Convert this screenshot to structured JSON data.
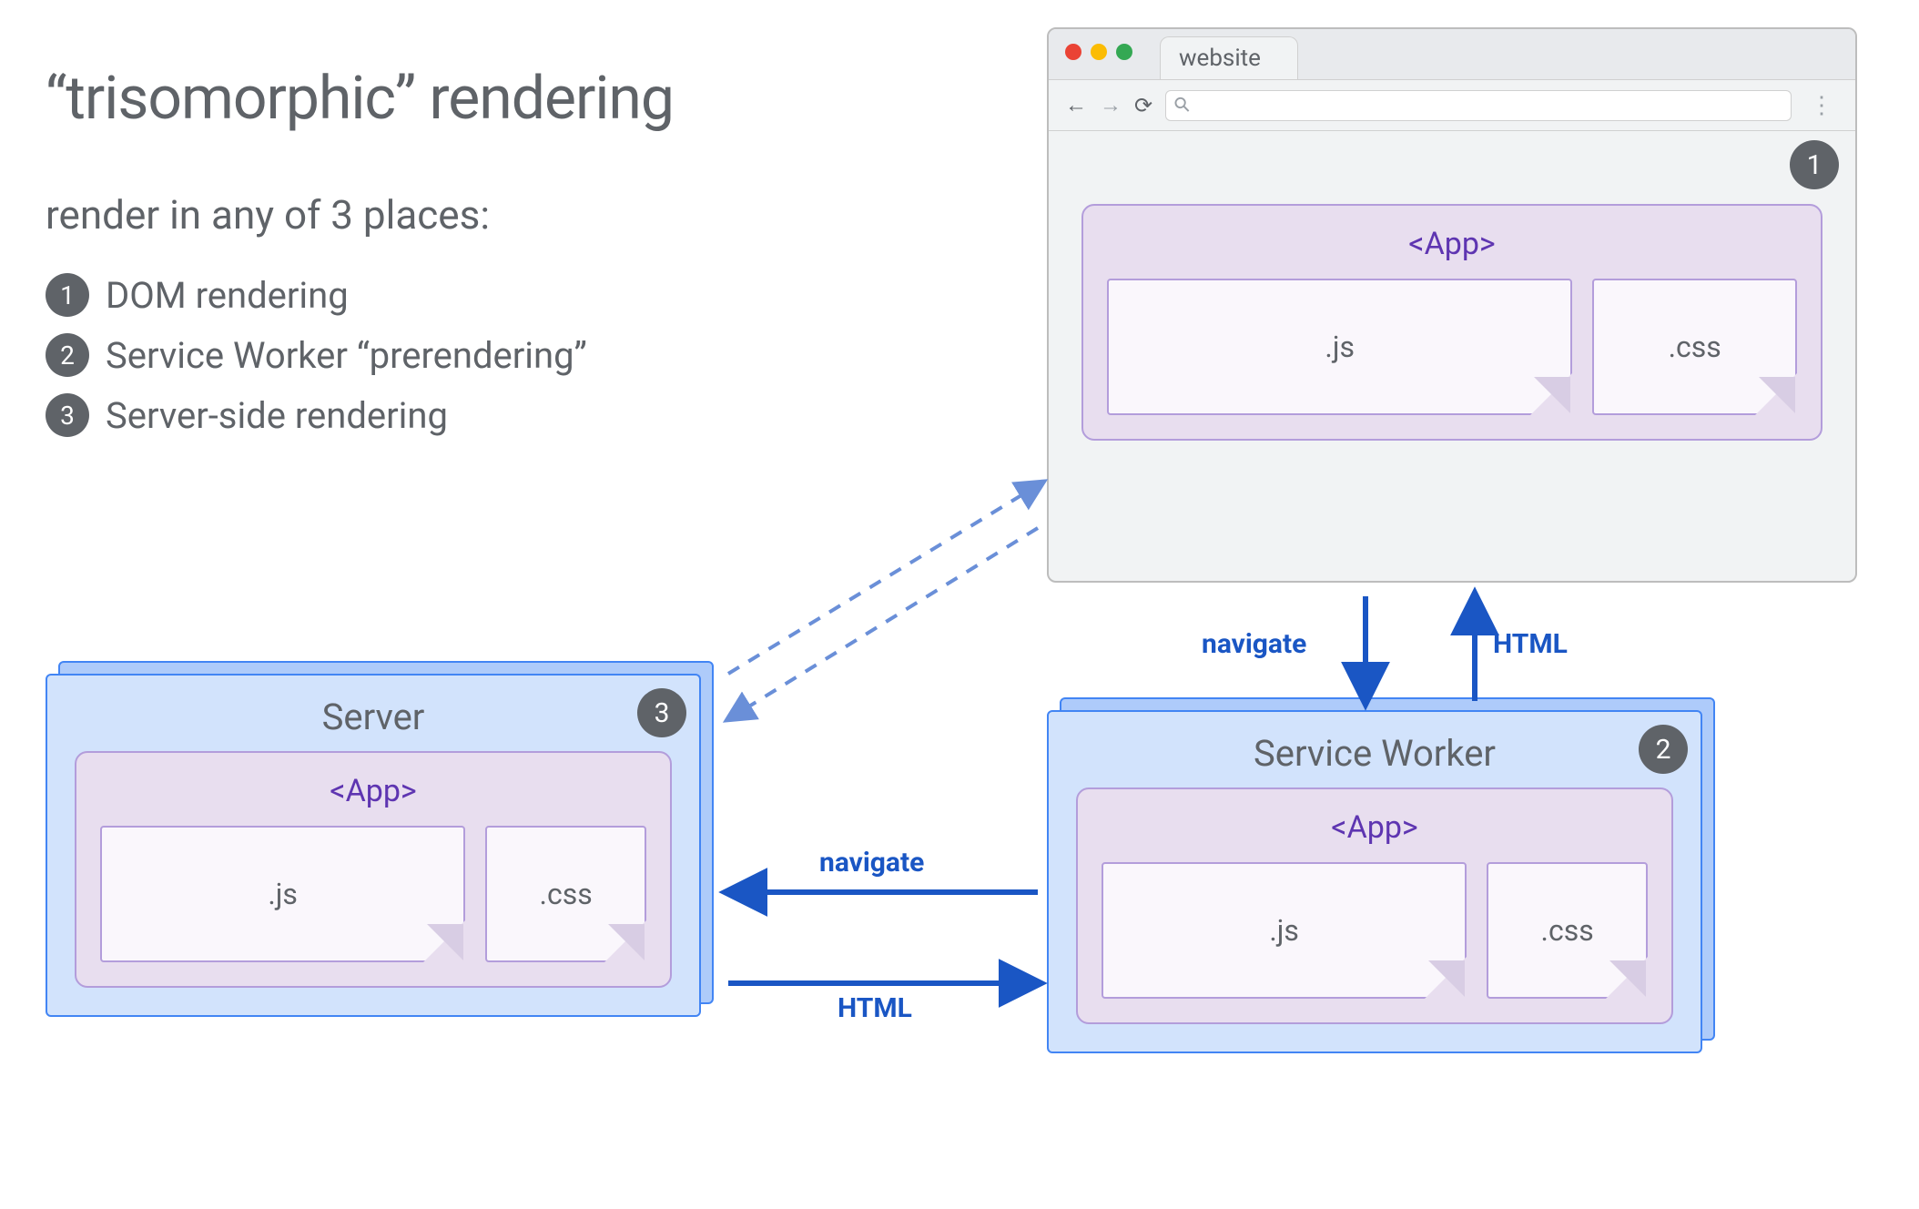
{
  "title": "“trisomorphic” rendering",
  "subtitle": "render in any of 3 places:",
  "items": [
    {
      "num": "1",
      "label": "DOM rendering"
    },
    {
      "num": "2",
      "label": "Service Worker “prerendering”"
    },
    {
      "num": "3",
      "label": "Server-side rendering"
    }
  ],
  "browser": {
    "tab_label": "website",
    "search_glyph": "⚲",
    "badge": "1",
    "app_label": "<App>",
    "js_label": ".js",
    "css_label": ".css"
  },
  "server": {
    "title": "Server",
    "badge": "3",
    "app_label": "<App>",
    "js_label": ".js",
    "css_label": ".css"
  },
  "sw": {
    "title": "Service Worker",
    "badge": "2",
    "app_label": "<App>",
    "js_label": ".js",
    "css_label": ".css"
  },
  "arrows": {
    "browser_sw_down": "navigate",
    "browser_sw_up": "HTML",
    "sw_server_left": "navigate",
    "sw_server_right": "HTML"
  },
  "colors": {
    "text": "#5f6368",
    "blue_fill": "#d2e3fc",
    "blue_stroke": "#4285f4",
    "purple_fill": "#e8deef",
    "purple_stroke": "#b39ddb",
    "arrow": "#1a56c4",
    "badge": "#5f6368"
  }
}
